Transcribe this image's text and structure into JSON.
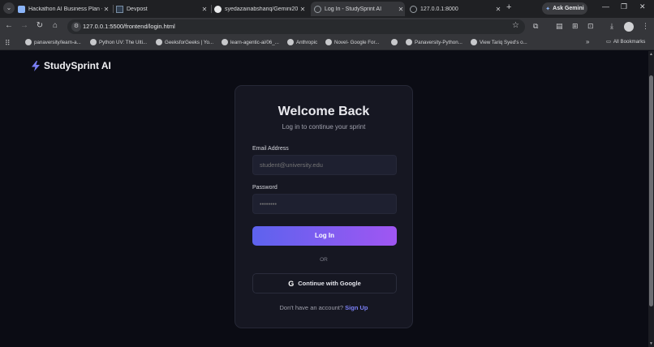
{
  "browser": {
    "tabs": [
      {
        "title": "Hackathon AI Business Plan -",
        "favicon_color": "#8ab4f8",
        "active": false
      },
      {
        "title": "Devpost",
        "favicon_color": "#2f3d4e",
        "active": false
      },
      {
        "title": "syedazainabshariq/Gemini20 (",
        "favicon_color": "#e8e9eb",
        "active": false
      },
      {
        "title": "Log In - StudySprint AI",
        "favicon_color": "#9aa0a6",
        "active": true
      },
      {
        "title": "127.0.0.1:8000",
        "favicon_color": "#9aa0a6",
        "active": false
      }
    ],
    "ask_gemini_label": "Ask Gemini",
    "url": "127.0.0.1:5500/frontend/login.html",
    "bookmarks": [
      "panaversity/learn-a...",
      "Python UV: The Ulti...",
      "GeeksforGeeks | Yo...",
      "learn-agentic-ai/06_...",
      "Anthropic",
      "Novel- Google For...",
      "",
      "Panaversity-Python...",
      "View Tariq Syed's o..."
    ],
    "all_bookmarks_label": "All Bookmarks"
  },
  "brand": {
    "name": "StudySprint AI",
    "accent": "#7a7ff5"
  },
  "login": {
    "title": "Welcome Back",
    "subtitle": "Log in to continue your sprint",
    "email_label": "Email Address",
    "email_placeholder": "student@university.edu",
    "password_label": "Password",
    "password_placeholder": "••••••••",
    "login_button": "Log In",
    "divider_text": "OR",
    "google_button": "Continue with Google",
    "signup_prompt": "Don't have an account?",
    "signup_link": "Sign Up"
  }
}
